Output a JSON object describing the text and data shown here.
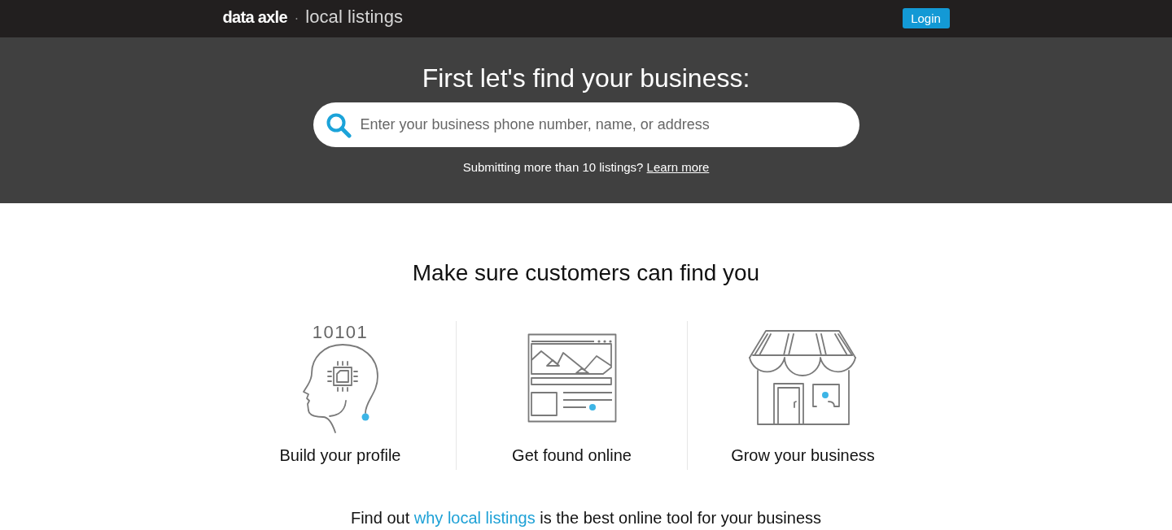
{
  "header": {
    "logo": {
      "brand": "data axle",
      "separator": "·",
      "product": "local listings"
    },
    "login_button": "Login"
  },
  "hero": {
    "title": "First let's find your business:",
    "search": {
      "placeholder": "Enter your business phone number, name, or address"
    },
    "note": {
      "text": "Submitting more than 10 listings?",
      "link": "Learn more"
    }
  },
  "features": {
    "title": "Make sure customers can find you",
    "items": [
      {
        "kind": "profile",
        "icon_text": "10101",
        "label": "Build your profile"
      },
      {
        "kind": "online",
        "label": "Get found online"
      },
      {
        "kind": "store",
        "label": "Grow your business"
      }
    ]
  },
  "promo": {
    "before": "Find out",
    "link": "why local listings",
    "after": "is the best online tool for your business"
  }
}
